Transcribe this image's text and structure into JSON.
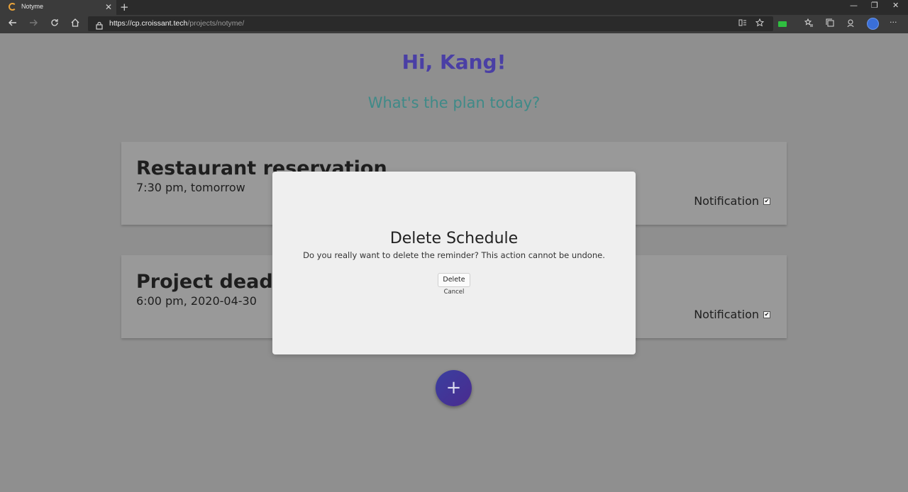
{
  "browser": {
    "tab_title": "Notyme",
    "tab_close": "✕",
    "new_tab": "+",
    "url_host": "https://cp.croissant.tech",
    "url_path": "/projects/notyme/",
    "window_controls": [
      "—",
      "❐",
      "✕"
    ],
    "more_menu": "···"
  },
  "page": {
    "greeting": "Hi, Kang!",
    "subtitle": "What's the plan today?",
    "add_button": "+"
  },
  "schedules": [
    {
      "title": "Restaurant reservation",
      "time": "7:30 pm, tomorrow",
      "notification_label": "Notification",
      "notification_checked": true
    },
    {
      "title": "Project deadline",
      "time": "6:00 pm, 2020-04-30",
      "notification_label": "Notification",
      "notification_checked": true
    }
  ],
  "modal": {
    "title": "Delete Schedule",
    "message": "Do you really want to delete the reminder? This action cannot be undone.",
    "delete_label": "Delete",
    "cancel_label": "Cancel"
  },
  "colors": {
    "greeting": "#4a3fa5",
    "subtitle": "#3f8a88",
    "overlay_background": "#8f8f8f",
    "fab_gradient": [
      "#3a3f9f",
      "#4a2b8f"
    ]
  },
  "icons": {
    "back": "back-arrow-icon",
    "forward": "forward-arrow-icon",
    "refresh": "refresh-icon",
    "home": "home-icon",
    "lock": "lock-icon",
    "favorite": "star-icon",
    "favorites_list": "favorites-icon",
    "collections": "collections-icon",
    "profile": "profile-avatar",
    "checkbox": "checkbox-checked-icon"
  }
}
